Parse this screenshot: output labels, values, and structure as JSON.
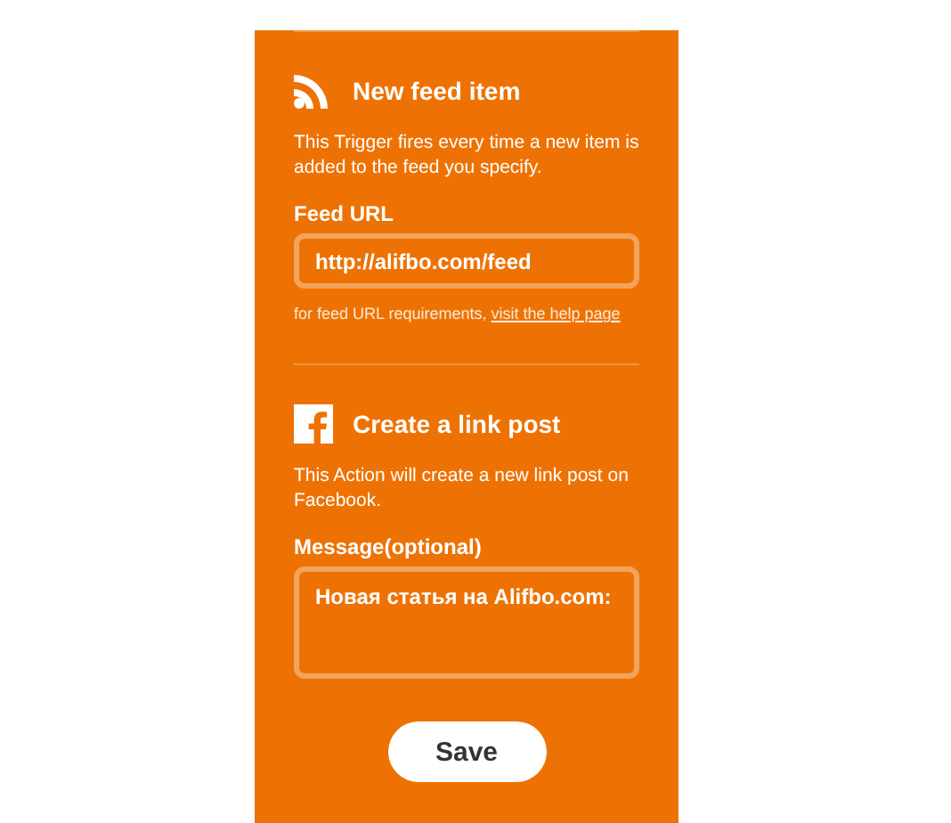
{
  "sections": [
    {
      "kind": "trigger",
      "title": "New feed item",
      "description": "This Trigger fires every time a new item is added to the feed you specify.",
      "field": {
        "kind": "input",
        "label": "Feed URL",
        "value": "http://alifbo.com/feed"
      },
      "help": {
        "text": "for feed URL requirements, ",
        "link": "visit the help page"
      }
    },
    {
      "kind": "action",
      "title": "Create a link post",
      "description": "This Action will create a new link post on Facebook.",
      "field": {
        "kind": "textarea",
        "label": "Message(optional)",
        "value": "Новая статья на Alifbo.com:"
      }
    }
  ],
  "save_button": "Save"
}
